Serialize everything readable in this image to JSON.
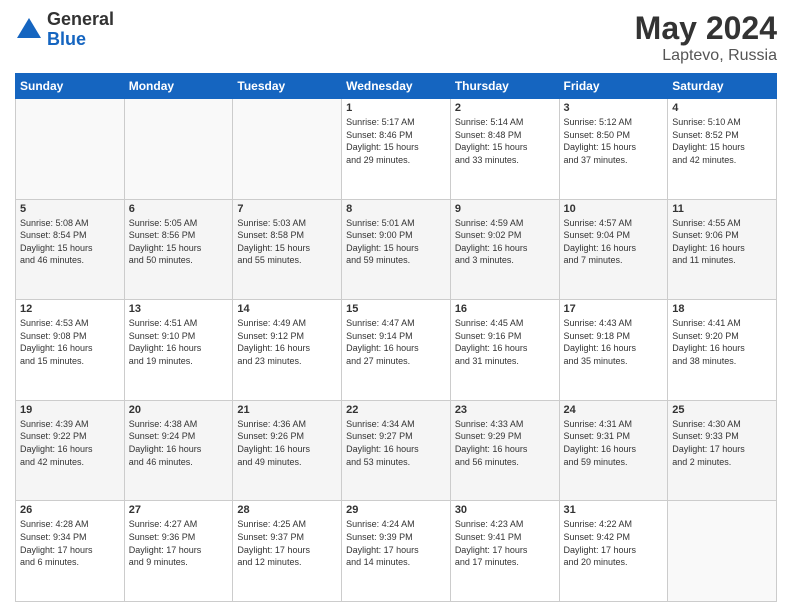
{
  "header": {
    "logo_general": "General",
    "logo_blue": "Blue",
    "title": "May 2024",
    "location": "Laptevo, Russia"
  },
  "columns": [
    "Sunday",
    "Monday",
    "Tuesday",
    "Wednesday",
    "Thursday",
    "Friday",
    "Saturday"
  ],
  "weeks": [
    [
      {
        "day": "",
        "info": ""
      },
      {
        "day": "",
        "info": ""
      },
      {
        "day": "",
        "info": ""
      },
      {
        "day": "1",
        "info": "Sunrise: 5:17 AM\nSunset: 8:46 PM\nDaylight: 15 hours\nand 29 minutes."
      },
      {
        "day": "2",
        "info": "Sunrise: 5:14 AM\nSunset: 8:48 PM\nDaylight: 15 hours\nand 33 minutes."
      },
      {
        "day": "3",
        "info": "Sunrise: 5:12 AM\nSunset: 8:50 PM\nDaylight: 15 hours\nand 37 minutes."
      },
      {
        "day": "4",
        "info": "Sunrise: 5:10 AM\nSunset: 8:52 PM\nDaylight: 15 hours\nand 42 minutes."
      }
    ],
    [
      {
        "day": "5",
        "info": "Sunrise: 5:08 AM\nSunset: 8:54 PM\nDaylight: 15 hours\nand 46 minutes."
      },
      {
        "day": "6",
        "info": "Sunrise: 5:05 AM\nSunset: 8:56 PM\nDaylight: 15 hours\nand 50 minutes."
      },
      {
        "day": "7",
        "info": "Sunrise: 5:03 AM\nSunset: 8:58 PM\nDaylight: 15 hours\nand 55 minutes."
      },
      {
        "day": "8",
        "info": "Sunrise: 5:01 AM\nSunset: 9:00 PM\nDaylight: 15 hours\nand 59 minutes."
      },
      {
        "day": "9",
        "info": "Sunrise: 4:59 AM\nSunset: 9:02 PM\nDaylight: 16 hours\nand 3 minutes."
      },
      {
        "day": "10",
        "info": "Sunrise: 4:57 AM\nSunset: 9:04 PM\nDaylight: 16 hours\nand 7 minutes."
      },
      {
        "day": "11",
        "info": "Sunrise: 4:55 AM\nSunset: 9:06 PM\nDaylight: 16 hours\nand 11 minutes."
      }
    ],
    [
      {
        "day": "12",
        "info": "Sunrise: 4:53 AM\nSunset: 9:08 PM\nDaylight: 16 hours\nand 15 minutes."
      },
      {
        "day": "13",
        "info": "Sunrise: 4:51 AM\nSunset: 9:10 PM\nDaylight: 16 hours\nand 19 minutes."
      },
      {
        "day": "14",
        "info": "Sunrise: 4:49 AM\nSunset: 9:12 PM\nDaylight: 16 hours\nand 23 minutes."
      },
      {
        "day": "15",
        "info": "Sunrise: 4:47 AM\nSunset: 9:14 PM\nDaylight: 16 hours\nand 27 minutes."
      },
      {
        "day": "16",
        "info": "Sunrise: 4:45 AM\nSunset: 9:16 PM\nDaylight: 16 hours\nand 31 minutes."
      },
      {
        "day": "17",
        "info": "Sunrise: 4:43 AM\nSunset: 9:18 PM\nDaylight: 16 hours\nand 35 minutes."
      },
      {
        "day": "18",
        "info": "Sunrise: 4:41 AM\nSunset: 9:20 PM\nDaylight: 16 hours\nand 38 minutes."
      }
    ],
    [
      {
        "day": "19",
        "info": "Sunrise: 4:39 AM\nSunset: 9:22 PM\nDaylight: 16 hours\nand 42 minutes."
      },
      {
        "day": "20",
        "info": "Sunrise: 4:38 AM\nSunset: 9:24 PM\nDaylight: 16 hours\nand 46 minutes."
      },
      {
        "day": "21",
        "info": "Sunrise: 4:36 AM\nSunset: 9:26 PM\nDaylight: 16 hours\nand 49 minutes."
      },
      {
        "day": "22",
        "info": "Sunrise: 4:34 AM\nSunset: 9:27 PM\nDaylight: 16 hours\nand 53 minutes."
      },
      {
        "day": "23",
        "info": "Sunrise: 4:33 AM\nSunset: 9:29 PM\nDaylight: 16 hours\nand 56 minutes."
      },
      {
        "day": "24",
        "info": "Sunrise: 4:31 AM\nSunset: 9:31 PM\nDaylight: 16 hours\nand 59 minutes."
      },
      {
        "day": "25",
        "info": "Sunrise: 4:30 AM\nSunset: 9:33 PM\nDaylight: 17 hours\nand 2 minutes."
      }
    ],
    [
      {
        "day": "26",
        "info": "Sunrise: 4:28 AM\nSunset: 9:34 PM\nDaylight: 17 hours\nand 6 minutes."
      },
      {
        "day": "27",
        "info": "Sunrise: 4:27 AM\nSunset: 9:36 PM\nDaylight: 17 hours\nand 9 minutes."
      },
      {
        "day": "28",
        "info": "Sunrise: 4:25 AM\nSunset: 9:37 PM\nDaylight: 17 hours\nand 12 minutes."
      },
      {
        "day": "29",
        "info": "Sunrise: 4:24 AM\nSunset: 9:39 PM\nDaylight: 17 hours\nand 14 minutes."
      },
      {
        "day": "30",
        "info": "Sunrise: 4:23 AM\nSunset: 9:41 PM\nDaylight: 17 hours\nand 17 minutes."
      },
      {
        "day": "31",
        "info": "Sunrise: 4:22 AM\nSunset: 9:42 PM\nDaylight: 17 hours\nand 20 minutes."
      },
      {
        "day": "",
        "info": ""
      }
    ]
  ]
}
